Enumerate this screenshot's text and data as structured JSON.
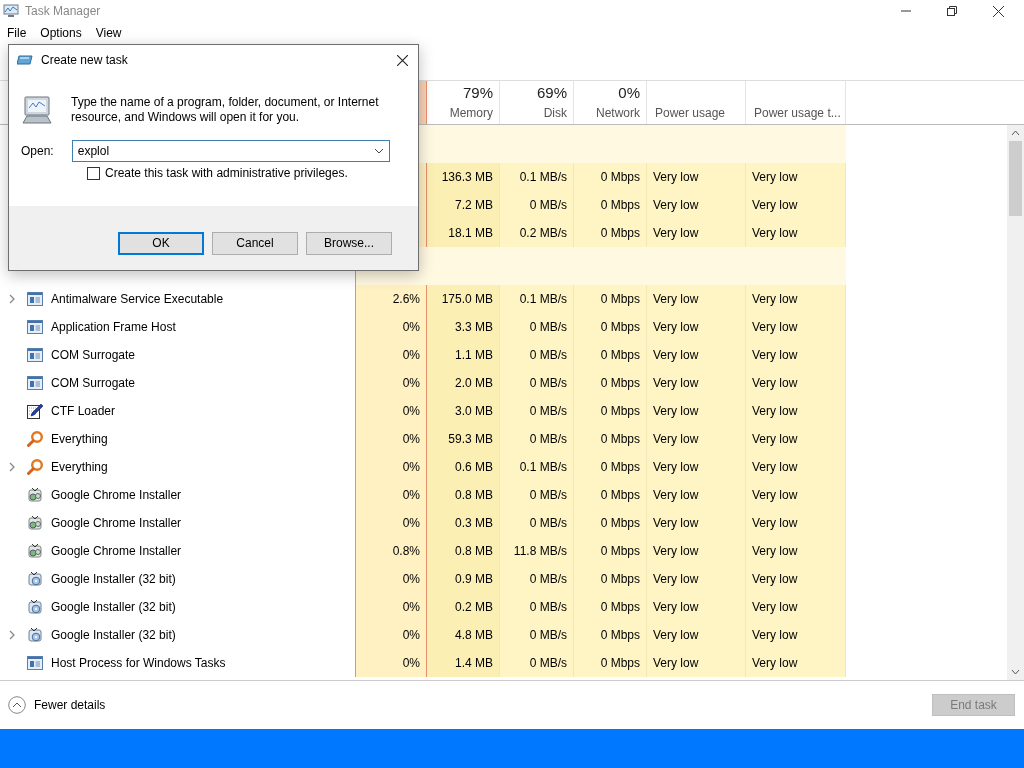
{
  "window": {
    "title": "Task Manager",
    "menu": [
      "File",
      "Options",
      "View"
    ]
  },
  "columns": [
    {
      "percent": "79%",
      "label": "Memory"
    },
    {
      "percent": "69%",
      "label": "Disk"
    },
    {
      "percent": "0%",
      "label": "Network"
    },
    {
      "label": "Power usage"
    },
    {
      "label": "Power usage t..."
    }
  ],
  "app_rows": [
    {
      "values": [
        "136.3 MB",
        "0.1 MB/s",
        "0 Mbps",
        "Very low",
        "Very low"
      ]
    },
    {
      "values": [
        "7.2 MB",
        "0 MB/s",
        "0 Mbps",
        "Very low",
        "Very low"
      ]
    },
    {
      "values": [
        "18.1 MB",
        "0.2 MB/s",
        "0 Mbps",
        "Very low",
        "Very low"
      ]
    }
  ],
  "background_rows": [
    {
      "name": "Antimalware Service Executable",
      "kind": "window",
      "expandable": true,
      "cpu": "2.6%",
      "values": [
        "175.0 MB",
        "0.1 MB/s",
        "0 Mbps",
        "Very low",
        "Very low"
      ]
    },
    {
      "name": "Application Frame Host",
      "kind": "window",
      "expandable": false,
      "cpu": "0%",
      "values": [
        "3.3 MB",
        "0 MB/s",
        "0 Mbps",
        "Very low",
        "Very low"
      ]
    },
    {
      "name": "COM Surrogate",
      "kind": "window",
      "expandable": false,
      "cpu": "0%",
      "values": [
        "1.1 MB",
        "0 MB/s",
        "0 Mbps",
        "Very low",
        "Very low"
      ]
    },
    {
      "name": "COM Surrogate",
      "kind": "window",
      "expandable": false,
      "cpu": "0%",
      "values": [
        "2.0 MB",
        "0 MB/s",
        "0 Mbps",
        "Very low",
        "Very low"
      ]
    },
    {
      "name": "CTF Loader",
      "kind": "pen",
      "expandable": false,
      "cpu": "0%",
      "values": [
        "3.0 MB",
        "0 MB/s",
        "0 Mbps",
        "Very low",
        "Very low"
      ]
    },
    {
      "name": "Everything",
      "kind": "magnifier",
      "expandable": false,
      "cpu": "0%",
      "values": [
        "59.3 MB",
        "0 MB/s",
        "0 Mbps",
        "Very low",
        "Very low"
      ]
    },
    {
      "name": "Everything",
      "kind": "magnifier",
      "expandable": true,
      "cpu": "0%",
      "values": [
        "0.6 MB",
        "0.1 MB/s",
        "0 Mbps",
        "Very low",
        "Very low"
      ]
    },
    {
      "name": "Google Chrome Installer",
      "kind": "installer",
      "expandable": false,
      "cpu": "0%",
      "values": [
        "0.8 MB",
        "0 MB/s",
        "0 Mbps",
        "Very low",
        "Very low"
      ]
    },
    {
      "name": "Google Chrome Installer",
      "kind": "installer",
      "expandable": false,
      "cpu": "0%",
      "values": [
        "0.3 MB",
        "0 MB/s",
        "0 Mbps",
        "Very low",
        "Very low"
      ]
    },
    {
      "name": "Google Chrome Installer",
      "kind": "installer",
      "expandable": false,
      "cpu": "0.8%",
      "values": [
        "0.8 MB",
        "11.8 MB/s",
        "0 Mbps",
        "Very low",
        "Very low"
      ]
    },
    {
      "name": "Google Installer (32 bit)",
      "kind": "disc",
      "expandable": false,
      "cpu": "0%",
      "values": [
        "0.9 MB",
        "0 MB/s",
        "0 Mbps",
        "Very low",
        "Very low"
      ]
    },
    {
      "name": "Google Installer (32 bit)",
      "kind": "disc",
      "expandable": false,
      "cpu": "0%",
      "values": [
        "0.2 MB",
        "0 MB/s",
        "0 Mbps",
        "Very low",
        "Very low"
      ]
    },
    {
      "name": "Google Installer (32 bit)",
      "kind": "disc",
      "expandable": true,
      "cpu": "0%",
      "values": [
        "4.8 MB",
        "0 MB/s",
        "0 Mbps",
        "Very low",
        "Very low"
      ]
    },
    {
      "name": "Host Process for Windows Tasks",
      "kind": "window",
      "expandable": false,
      "cpu": "0%",
      "values": [
        "1.4 MB",
        "0 MB/s",
        "0 Mbps",
        "Very low",
        "Very low"
      ]
    }
  ],
  "footer": {
    "fewer_details": "Fewer details",
    "end_task": {
      "label": "End task",
      "disabled": true
    }
  },
  "dialog": {
    "title": "Create new task",
    "message": "Type the name of a program, folder, document, or Internet resource, and Windows will open it for you.",
    "open_label": "Open:",
    "value": "explol",
    "admin_checkbox": {
      "label": "Create this task with administrative privileges.",
      "checked": false
    },
    "buttons": [
      {
        "label": "OK",
        "default": true
      },
      {
        "label": "Cancel",
        "default": false
      },
      {
        "label": "Browse...",
        "default": false
      }
    ]
  }
}
